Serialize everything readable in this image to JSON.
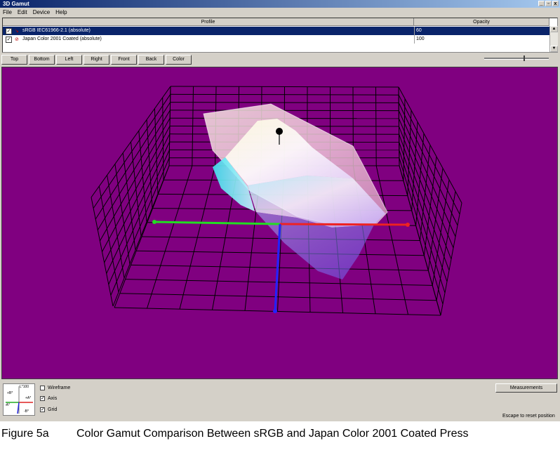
{
  "window": {
    "title": "3D Gamut",
    "controls": [
      "_",
      "▫",
      "x"
    ]
  },
  "menu": [
    "File",
    "Edit",
    "Device",
    "Help"
  ],
  "profiles_table": {
    "columns": [
      "Profile",
      "Opacity"
    ],
    "rows": [
      {
        "checked": true,
        "name": "sRGB IEC61966-2.1 (absolute)",
        "opacity": "60",
        "selected": true
      },
      {
        "checked": true,
        "name": "Japan Color 2001 Coated (absolute)",
        "opacity": "100",
        "selected": false
      }
    ]
  },
  "view_buttons": [
    "Top",
    "Bottom",
    "Left",
    "Right",
    "Front",
    "Back",
    "Color"
  ],
  "zoom_slider": {
    "value": 0.62
  },
  "viewport": {
    "background": "#800080"
  },
  "axis_widget": {
    "labels": [
      "L*100",
      "+B*",
      "-A*",
      "+A*",
      "-B*"
    ]
  },
  "options": [
    {
      "label": "Wireframe",
      "checked": false
    },
    {
      "label": "Axis",
      "checked": true
    },
    {
      "label": "Grid",
      "checked": true
    }
  ],
  "measurements_button": "Measurements",
  "status_hint": "Escape to reset position",
  "caption": {
    "figure": "Figure 5a",
    "text": "Color Gamut Comparison Between sRGB and Japan Color 2001 Coated Press"
  }
}
